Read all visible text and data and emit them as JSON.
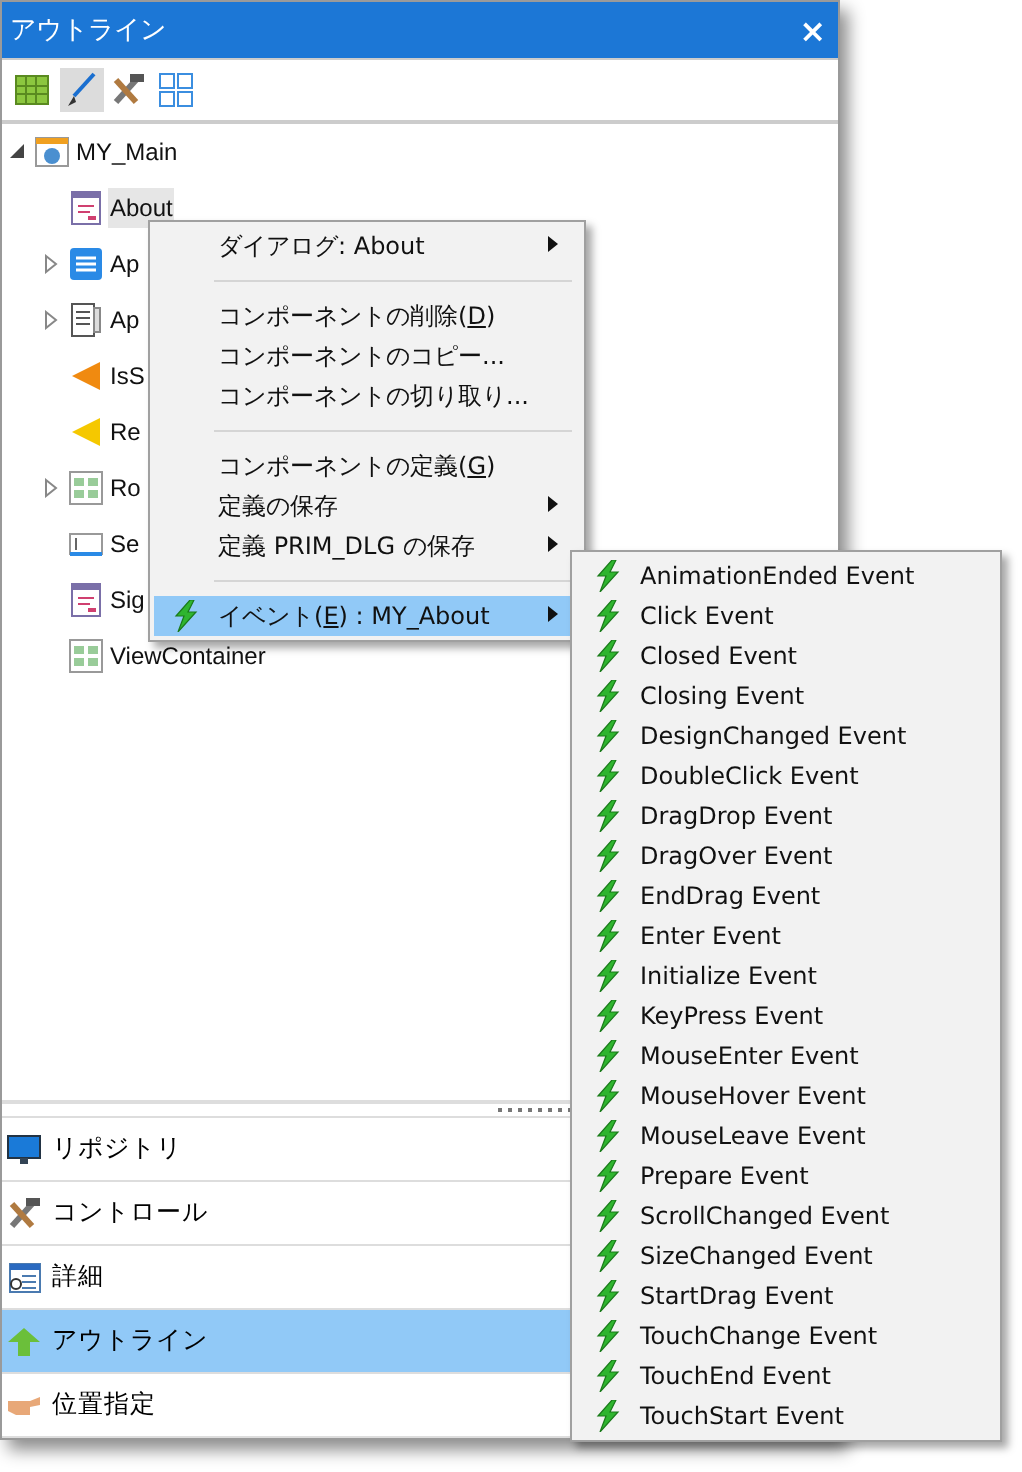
{
  "window": {
    "title": "アウトライン",
    "close": "×"
  },
  "toolbar": [
    {
      "kind": "grid",
      "selected": false
    },
    {
      "kind": "brush",
      "selected": true
    },
    {
      "kind": "tools",
      "selected": false
    },
    {
      "kind": "layout",
      "selected": false
    }
  ],
  "tree": [
    {
      "label": "MY_Main",
      "kind": "app",
      "expanded": true,
      "selected": false,
      "children": [
        {
          "label": "About",
          "kind": "form",
          "selected": true,
          "expandable": false
        },
        {
          "label": "Ap",
          "kind": "list",
          "selected": false,
          "expandable": true
        },
        {
          "label": "Ap",
          "kind": "doc",
          "selected": false,
          "expandable": true
        },
        {
          "label": "IsS",
          "kind": "orange",
          "selected": false,
          "expandable": false
        },
        {
          "label": "Re",
          "kind": "yellow",
          "selected": false,
          "expandable": false
        },
        {
          "label": "Ro",
          "kind": "view",
          "selected": false,
          "expandable": true
        },
        {
          "label": "Se",
          "kind": "field",
          "selected": false,
          "expandable": false
        },
        {
          "label": "Sig",
          "kind": "form",
          "selected": false,
          "expandable": false
        },
        {
          "label": "ViewContainer",
          "kind": "view",
          "selected": false,
          "expandable": false
        }
      ]
    }
  ],
  "context_menu": [
    {
      "kind": "item",
      "before": "ダイアログ: About",
      "submenu": true,
      "selected": false
    },
    {
      "kind": "separator"
    },
    {
      "kind": "item",
      "before": "コンポーネントの削除(",
      "key": "D",
      "after": ")",
      "submenu": false,
      "selected": false
    },
    {
      "kind": "item",
      "before": "コンポーネントのコピー...",
      "submenu": false,
      "selected": false
    },
    {
      "kind": "item",
      "before": "コンポーネントの切り取り...",
      "submenu": false,
      "selected": false
    },
    {
      "kind": "separator"
    },
    {
      "kind": "item",
      "before": "コンポーネントの定義(",
      "key": "G",
      "after": ")",
      "submenu": false,
      "selected": false
    },
    {
      "kind": "item",
      "before": "定義の保存",
      "submenu": true,
      "selected": false
    },
    {
      "kind": "item",
      "before": "定義 PRIM_DLG の保存",
      "submenu": true,
      "selected": false
    },
    {
      "kind": "separator"
    },
    {
      "kind": "item",
      "before": "イベント(",
      "key": "E",
      "after": ") : MY_About",
      "submenu": true,
      "selected": true,
      "icon": true
    }
  ],
  "event_menu": [
    "AnimationEnded Event",
    "Click Event",
    "Closed Event",
    "Closing Event",
    "DesignChanged Event",
    "DoubleClick Event",
    "DragDrop Event",
    "DragOver Event",
    "EndDrag Event",
    "Enter Event",
    "Initialize Event",
    "KeyPress Event",
    "MouseEnter Event",
    "MouseHover Event",
    "MouseLeave Event",
    "Prepare Event",
    "ScrollChanged Event",
    "SizeChanged Event",
    "StartDrag Event",
    "TouchChange Event",
    "TouchEnd Event",
    "TouchStart Event"
  ],
  "nav": [
    {
      "label": "リポジトリ",
      "kind": "monitor",
      "selected": false
    },
    {
      "label": "コントロール",
      "kind": "tools",
      "selected": false
    },
    {
      "label": "詳細",
      "kind": "details",
      "selected": false
    },
    {
      "label": "アウトライン",
      "kind": "arrow",
      "selected": true
    },
    {
      "label": "位置指定",
      "kind": "hand",
      "selected": false
    }
  ]
}
